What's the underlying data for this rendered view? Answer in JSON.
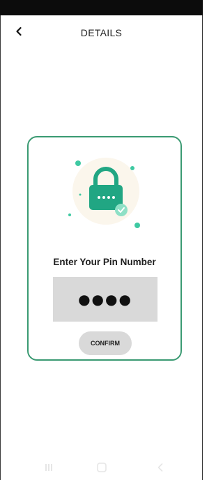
{
  "header": {
    "title": "DETAILS",
    "back_icon": "chevron-left-icon"
  },
  "card": {
    "illustration_icon": "padlock-check-icon",
    "heading": "Enter Your Pin Number",
    "pin_value": "●●●●",
    "confirm_label": "CONFIRM",
    "accent_color": "#3a9a72",
    "lock_color": "#21a683"
  },
  "nav_bar": {
    "icons": [
      "recent-apps-icon",
      "home-icon",
      "back-icon"
    ]
  }
}
